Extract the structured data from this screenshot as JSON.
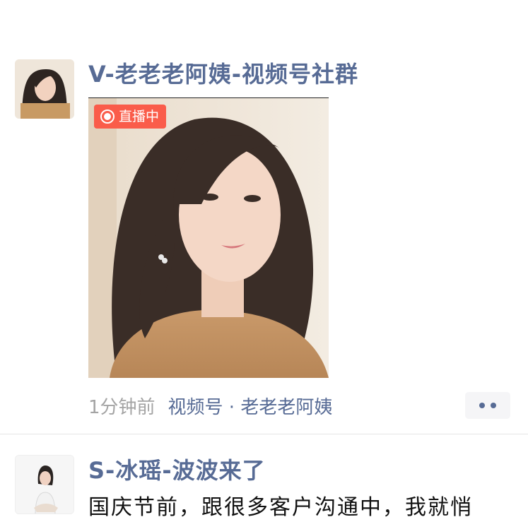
{
  "posts": [
    {
      "author": "V-老老老阿姨-视频号社群",
      "live_badge": "直播中",
      "time": "1分钟前",
      "source": "视频号 · 老老老阿姨"
    },
    {
      "author": "S-冰瑶-波波来了",
      "text": "国庆节前，跟很多客户沟通中，我就悄"
    }
  ],
  "colors": {
    "link_blue": "#576b95",
    "live_red": "#fa5c4a",
    "time_gray": "#a4a4a4"
  }
}
